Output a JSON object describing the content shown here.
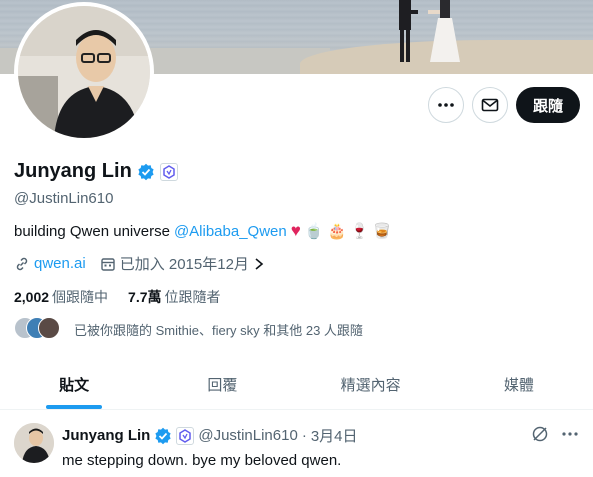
{
  "profile": {
    "name": "Junyang Lin",
    "handle": "@JustinLin610",
    "bio_text": "building Qwen universe",
    "bio_mention": "@Alibaba_Qwen",
    "bio_emojis": [
      "🍵",
      "🎂",
      "🍷",
      "🥃"
    ],
    "website": "qwen.ai",
    "joined": "已加入 2015年12月",
    "following_count": "2,002",
    "following_label": "個跟隨中",
    "followers_count": "7.7萬",
    "followers_label": "位跟隨者",
    "followed_by_text": "已被你跟隨的 Smithie、fiery sky 和其他 23 人跟隨"
  },
  "actions": {
    "more_icon": "more-horizontal-icon",
    "message_icon": "envelope-icon",
    "follow_label": "跟隨"
  },
  "tabs": [
    {
      "label": "貼文",
      "active": true
    },
    {
      "label": "回覆",
      "active": false
    },
    {
      "label": "精選內容",
      "active": false
    },
    {
      "label": "媒體",
      "active": false
    }
  ],
  "tweet": {
    "name": "Junyang Lin",
    "handle": "@JustinLin610",
    "separator": "·",
    "date": "3月4日",
    "text": "me stepping down. bye my beloved qwen."
  },
  "colors": {
    "accent": "#1d9bf0",
    "text": "#0f1419",
    "muted": "#536471",
    "heart": "#e0245e",
    "follow_bg": "#0f1419"
  }
}
